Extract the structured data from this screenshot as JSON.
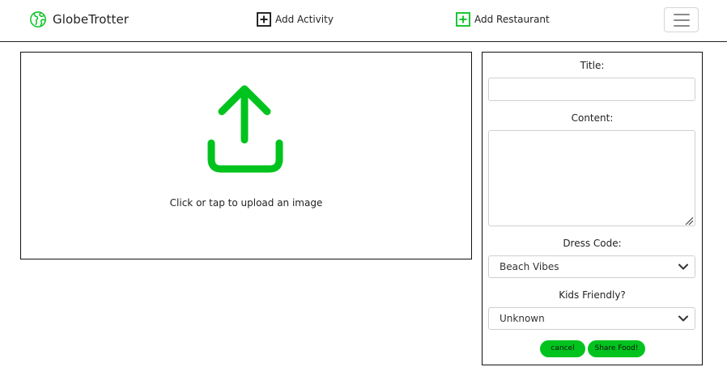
{
  "colors": {
    "accent": "#00c31e",
    "text": "#222222",
    "border": "#111111"
  },
  "navbar": {
    "brand": {
      "icon": "globe-icon",
      "label": "GlobeTrotter"
    },
    "links": [
      {
        "icon": "plus-square-icon",
        "label": "Add Activity"
      },
      {
        "icon": "plus-square-icon",
        "label": "Add Restaurant"
      }
    ],
    "menu_icon": "hamburger-menu-icon"
  },
  "upload": {
    "icon": "upload-icon",
    "text": "Click or tap to upload an image"
  },
  "form": {
    "title_label": "Title:",
    "title_value": "",
    "content_label": "Content:",
    "content_value": "",
    "dress_code_label": "Dress Code:",
    "dress_code_value": "Beach Vibes",
    "kids_label": "Kids Friendly?",
    "kids_value": "Unknown",
    "cancel_label": "cancel",
    "share_label": "Share Food!"
  }
}
